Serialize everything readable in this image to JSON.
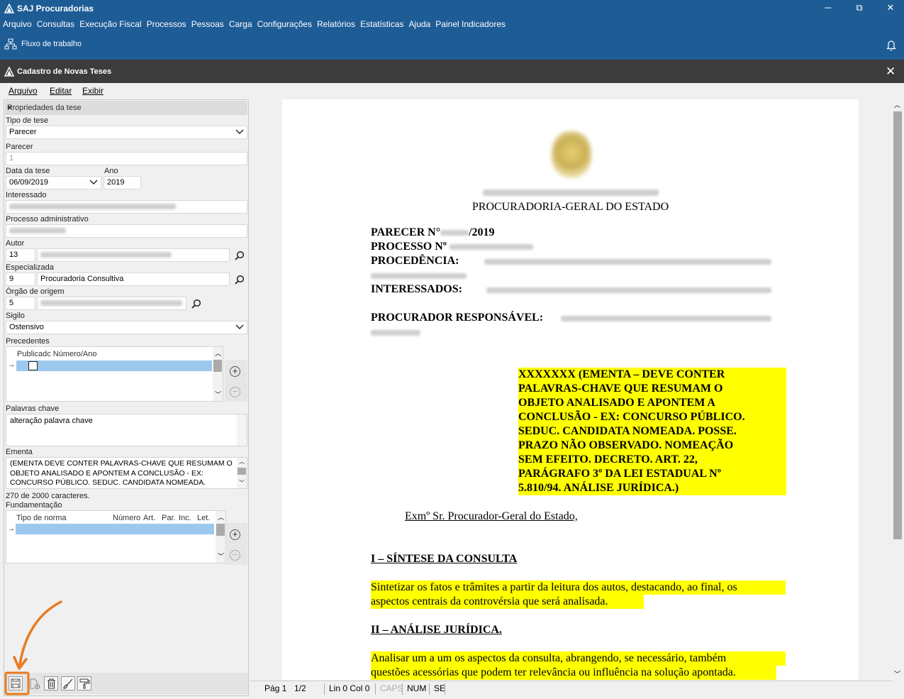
{
  "app": {
    "title": "SAJ Procuradorias",
    "minimize": "─",
    "restore": "⧉",
    "close": "✕"
  },
  "menu": [
    "Arquivo",
    "Consultas",
    "Execução Fiscal",
    "Processos",
    "Pessoas",
    "Carga",
    "Configurações",
    "Relatórios",
    "Estatísticas",
    "Ajuda",
    "Painel Indicadores"
  ],
  "toolbar": {
    "workflow": "Fluxo de trabalho"
  },
  "child": {
    "title": "Cadastro de Novas Teses",
    "close": "✕",
    "menu": [
      "Arquivo",
      "Editar",
      "Exibir"
    ]
  },
  "panel": {
    "title": "Propriedades da tese",
    "close": "×",
    "tipo_label": "Tipo de tese",
    "tipo_value": "Parecer",
    "parecer_label": "Parecer",
    "parecer_value": "1",
    "data_label": "Data da tese",
    "data_value": "06/09/2019",
    "ano_label": "Ano",
    "ano_value": "2019",
    "interessado_label": "Interessado",
    "processo_label": "Processo administrativo",
    "autor_label": "Autor",
    "autor_code": "13",
    "especializada_label": "Especializada",
    "especializada_code": "9",
    "especializada_value": "Procuradoria Consultiva",
    "orgao_label": "Órgão de origem",
    "orgao_code": "5",
    "sigilo_label": "Sigilo",
    "sigilo_value": "Ostensivo",
    "precedentes_label": "Precedentes",
    "precedentes_header": "Publicadc Número/Ano",
    "palavras_label": "Palavras chave",
    "palavras_value": "alteração palavra chave",
    "ementa_label": "Ementa",
    "ementa_value": " (EMENTA  DEVE CONTER PALAVRAS-CHAVE QUE RESUMAM O OBJETO ANALISADO E APONTEM A CONCLUSÃO - EX: CONCURSO PÚBLICO. SEDUC. CANDIDATA NOMEADA. POSSE.",
    "char_count": "270 de 2000 caracteres.",
    "fundamentacao_label": "Fundamentação",
    "fund_cols": [
      "Tipo de norma",
      "Número",
      "Art.",
      "Par.",
      "Inc.",
      "Let."
    ]
  },
  "document": {
    "header": "PROCURADORIA-GERAL DO ESTADO",
    "parecer": "PARECER N°",
    "parecer_year": "/2019",
    "processo": "PROCESSO Nº",
    "procedencia": "PROCEDÊNCIA:",
    "interessados": "INTERESSADOS:",
    "procurador": "PROCURADOR RESPONSÁVEL:",
    "ementa_lines": [
      "XXXXXXX (EMENTA – DEVE CONTER",
      "PALAVRAS-CHAVE QUE RESUMAM O",
      "OBJETO ANALISADO E APONTEM A",
      "CONCLUSÃO - EX: CONCURSO PÚBLICO.",
      "SEDUC. CANDIDATA NOMEADA. POSSE.",
      "PRAZO NÃO OBSERVADO. NOMEAÇÃO",
      "SEM EFEITO. DECRETO. ART. 22,",
      "PARÁGRAFO 3º DA LEI ESTADUAL Nº",
      "5.810/94. ANÁLISE JURÍDICA.)"
    ],
    "salutation": "Exmº Sr. Procurador-Geral do Estado,",
    "sec1_title": "I – SÍNTESE DA CONSULTA",
    "sec1_line1": "Sintetizar os fatos e trâmites a partir da leitura dos autos, destacando, ao final, os",
    "sec1_line2": "aspectos centrais da controvérsia que será analisada.",
    "sec2_title": "II – ANÁLISE JURÍDICA.",
    "sec2_line1": "Analisar um a um os aspectos da consulta, abrangendo, se necessário, também",
    "sec2_line2": "questões acessórias que podem ter relevância ou influência na solução apontada."
  },
  "status": {
    "page": "Pág 1",
    "pages": "1/2",
    "pos": "Lin 0  Col 0",
    "caps": "CAPS",
    "num": "NUM",
    "se": "SE"
  },
  "colors": {
    "titlebar": "#1e5c96",
    "highlight": "#ffff00",
    "arrow": "#e87a1e"
  }
}
